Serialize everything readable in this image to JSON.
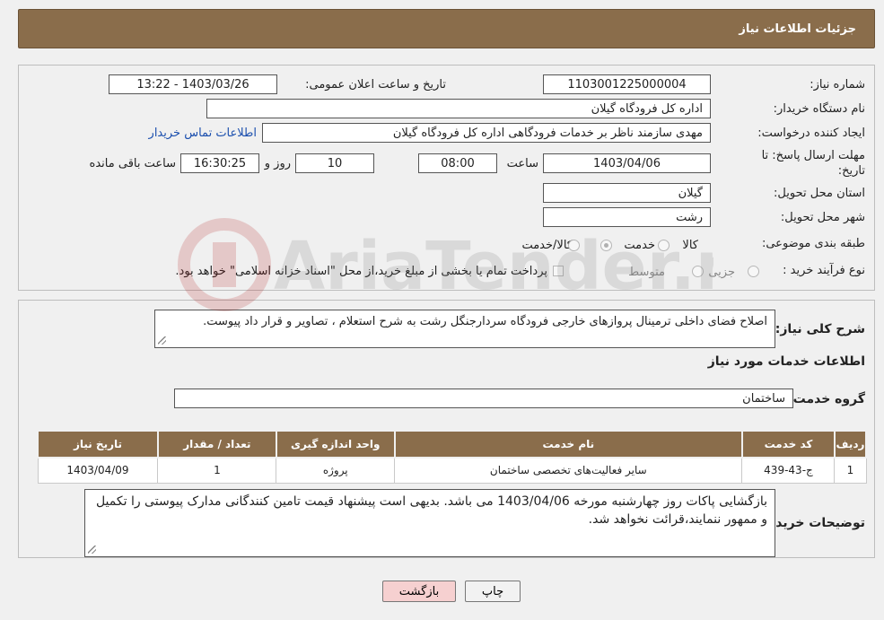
{
  "header": {
    "title": "جزئیات اطلاعات نیاز"
  },
  "request": {
    "number_label": "شماره نیاز:",
    "number": "1103001225000004",
    "announce_label": "تاریخ و ساعت اعلان عمومی:",
    "announce_value": "1403/03/26 - 13:22",
    "buyer_label": "نام دستگاه خریدار:",
    "buyer": "اداره کل فرودگاه گیلان",
    "creator_label": "ایجاد کننده درخواست:",
    "creator": "مهدی سازمند ناظر بر خدمات فرودگاهی اداره کل فرودگاه گیلان",
    "contact_link": "اطلاعات تماس خریدار",
    "deadline_label_1": "مهلت ارسال پاسخ: تا",
    "deadline_label_2": "تاریخ:",
    "deadline_date": "1403/04/06",
    "time_label": "ساعت",
    "deadline_time": "08:00",
    "days_value": "10",
    "days_label": "روز و",
    "remaining_value": "16:30:25",
    "remaining_label": "ساعت باقی مانده",
    "province_label": "استان محل تحویل:",
    "province": "گیلان",
    "city_label": "شهر محل تحویل:",
    "city": "رشت",
    "category_label": "طبقه بندی موضوعی:",
    "category_options": [
      "کالا",
      "خدمت",
      "کالا/خدمت"
    ],
    "process_label": "نوع فرآیند خرید :",
    "process_options": [
      "جزیی",
      "متوسط"
    ],
    "payment_note": "پرداخت تمام یا بخشی از مبلغ خرید،از محل \"اسناد خزانه اسلامی\" خواهد بود."
  },
  "details": {
    "summary_label": "شرح کلی نیاز:",
    "summary": "اصلاح فضای داخلی ترمینال پروازهای خارجی فرودگاه سردارجنگل رشت به شرح استعلام ، تصاویر و قرار داد پیوست.",
    "services_title": "اطلاعات خدمات مورد نیاز",
    "group_label": "گروه خدمت:",
    "group": "ساختمان",
    "table": {
      "headers": [
        "ردیف",
        "کد خدمت",
        "نام خدمت",
        "واحد اندازه گیری",
        "تعداد / مقدار",
        "تاریخ نیاز"
      ],
      "rows": [
        [
          "1",
          "ج-43-439",
          "سایر فعالیت‌های تخصصی ساختمان",
          "پروژه",
          "1",
          "1403/04/09"
        ]
      ]
    },
    "buyer_notes_label": "توضیحات خریدار:",
    "buyer_notes": "بازگشایی پاکات روز چهارشنبه مورخه 1403/04/06 می باشد. بدیهی است پیشنهاد قیمت تامین کنندگانی مدارک پیوستی را تکمیل و ممهور ننمایند،قرائت نخواهد شد."
  },
  "buttons": {
    "print": "چاپ",
    "back": "بازگشت"
  },
  "watermark": {
    "text": "AriaTender.neT"
  }
}
